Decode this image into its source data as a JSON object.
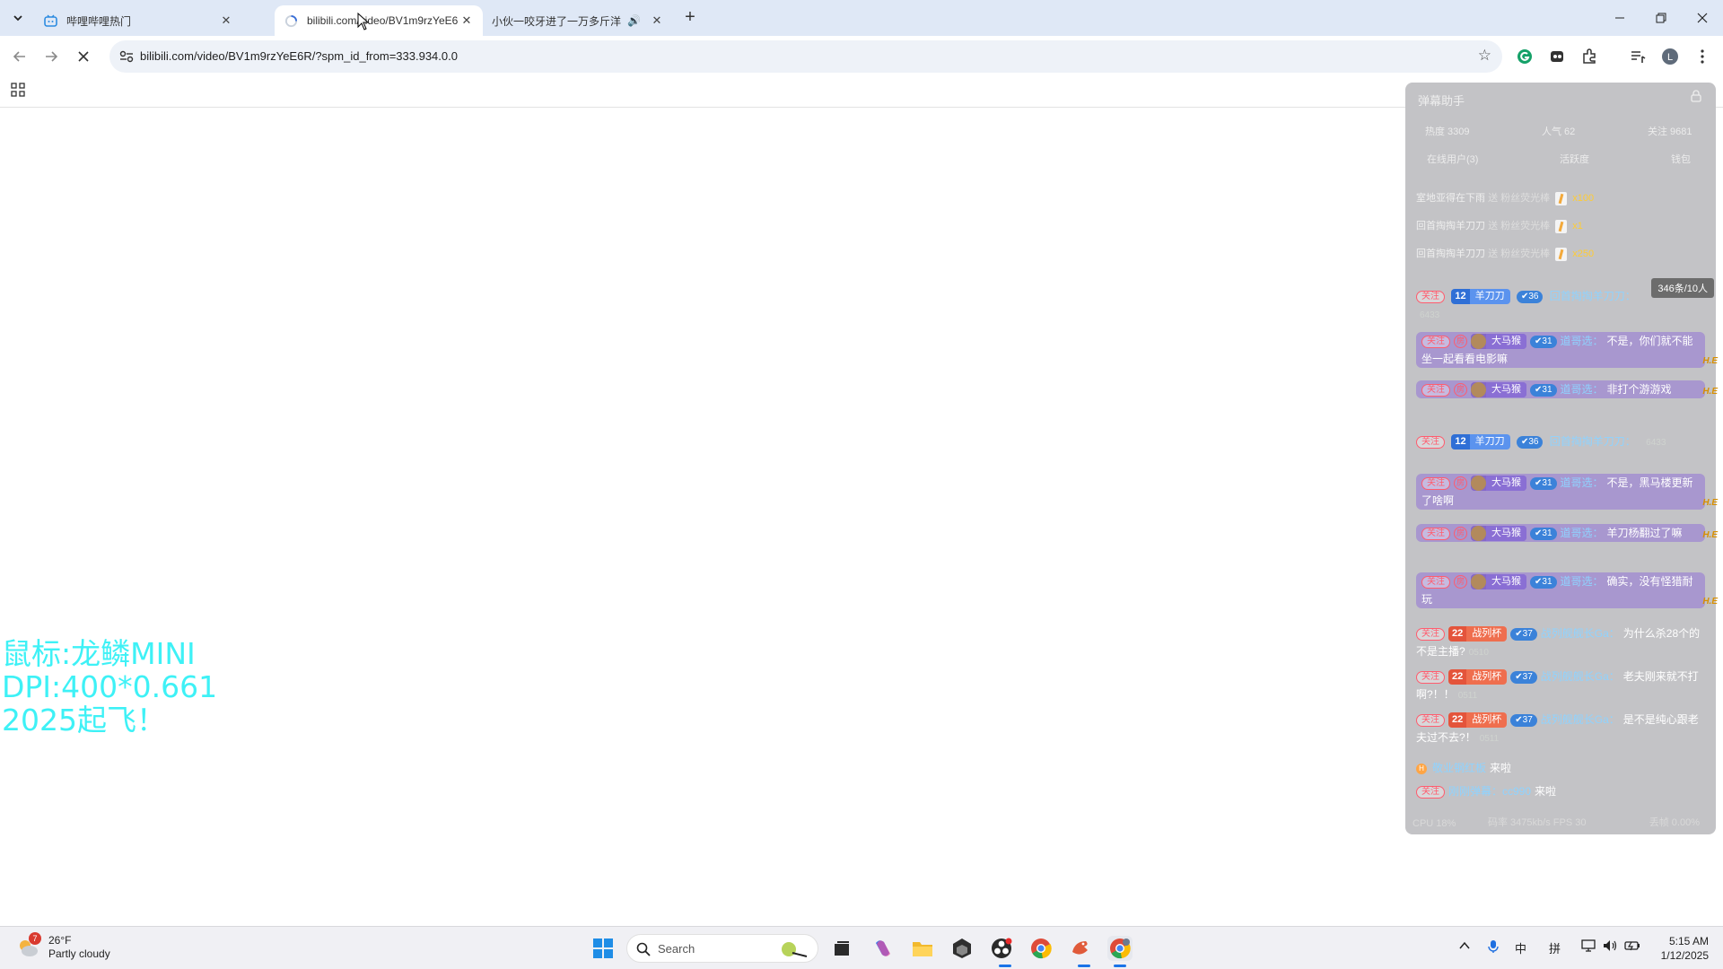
{
  "browser": {
    "tabs": [
      {
        "title": "哔哩哔哩热门",
        "active": false
      },
      {
        "title": "bilibili.com/video/BV1m9rzYeE6",
        "active": true
      },
      {
        "title": "小伙一咬牙进了一万多斤洋",
        "active": false,
        "audio": true
      }
    ],
    "url": "bilibili.com/video/BV1m9rzYeE6R/?spm_id_from=333.934.0.0"
  },
  "overlay": {
    "line1": "鼠标:龙鳞MINI",
    "line2": "DPI:400*0.661",
    "line3": "2025起飞！"
  },
  "panel": {
    "title": "弹幕助手",
    "stats": {
      "heat": "热度 3309",
      "popularity": "人气 62",
      "follow": "关注 9681"
    },
    "tabs": {
      "online": "在线用户(3)",
      "activity": "活跃度",
      "wallet": "钱包"
    },
    "gifts": [
      {
        "user": "室地亚得在下雨",
        "action": "送 粉丝荧光棒",
        "count": "x100"
      },
      {
        "user": "回首掏掏羊刀刀",
        "action": "送 粉丝荧光棒",
        "count": "x1"
      },
      {
        "user": "回首掏掏羊刀刀",
        "action": "送 粉丝荧光棒",
        "count": "x250"
      }
    ],
    "count_badge": "346条/10人",
    "follow_label": "关注",
    "room_label": "房",
    "messages": [
      {
        "kind": "plain",
        "medal_lv": "12",
        "medal_name": "羊刀刀",
        "guard": "36",
        "user": "回首掏掏羊刀刀：",
        "text": "",
        "ulv": "6433"
      },
      {
        "kind": "bubble",
        "medal_lv": "",
        "medal_name": "大马猴",
        "guard": "31",
        "user": "道哥选：",
        "text": "不是，你们就不能坐一起看看电影嘛",
        "tag": "H.E"
      },
      {
        "kind": "bubble",
        "medal_lv": "",
        "medal_name": "大马猴",
        "guard": "31",
        "user": "道哥选：",
        "text": "非打个游游戏",
        "tag": "H.E"
      },
      {
        "kind": "plain",
        "medal_lv": "12",
        "medal_name": "羊刀刀",
        "guard": "36",
        "user": "回首掏掏羊刀刀：",
        "text": "",
        "ulv": "6433"
      },
      {
        "kind": "bubble",
        "medal_lv": "",
        "medal_name": "大马猴",
        "guard": "31",
        "user": "道哥选：",
        "text": "不是，黑马楼更新了啥啊",
        "tag": "H.E"
      },
      {
        "kind": "bubble",
        "medal_lv": "",
        "medal_name": "大马猴",
        "guard": "31",
        "user": "道哥选：",
        "text": "羊刀杨翻过了嘛",
        "tag": "H.E"
      },
      {
        "kind": "bubble",
        "medal_lv": "",
        "medal_name": "大马猴",
        "guard": "31",
        "user": "道哥选：",
        "text": "确实，没有怪猎耐玩",
        "tag": "H.E"
      },
      {
        "kind": "red",
        "medal_lv": "22",
        "medal_name": "战列杯",
        "guard": "37",
        "user": "战列舰舰长Ga：",
        "text": "为什么杀28个的不是主播?",
        "ulv": "0510"
      },
      {
        "kind": "red",
        "medal_lv": "22",
        "medal_name": "战列杯",
        "guard": "37",
        "user": "战列舰舰长Ga：",
        "text": "老夫刚来就不打啊?！！",
        "ulv": "0511"
      },
      {
        "kind": "red",
        "medal_lv": "22",
        "medal_name": "战列杯",
        "guard": "37",
        "user": "战列舰舰长Ga：",
        "text": "是不是纯心跟老夫过不去?！",
        "ulv": "0511"
      }
    ],
    "enters": [
      {
        "user": "敬业钢红板",
        "text": "来啦"
      },
      {
        "user": "刚刚弹幕：cc990",
        "text": "来啦"
      }
    ],
    "footer": {
      "cpu": "CPU 18%",
      "bitrate": "码率 3475kb/s FPS 30",
      "loss": "丢帧 0.00%"
    }
  },
  "taskbar": {
    "weather_temp": "26°F",
    "weather_desc": "Partly cloudy",
    "weather_badge": "7",
    "search": "Search",
    "ime1": "中",
    "ime2": "拼",
    "time": "5:15 AM",
    "date": "1/12/2025"
  },
  "colors": {
    "overlay_text": "#3ef1f6",
    "tabstrip": "#dfe8f6",
    "panel_bg": "#c3c3c6",
    "bubble": "#a897cf"
  }
}
